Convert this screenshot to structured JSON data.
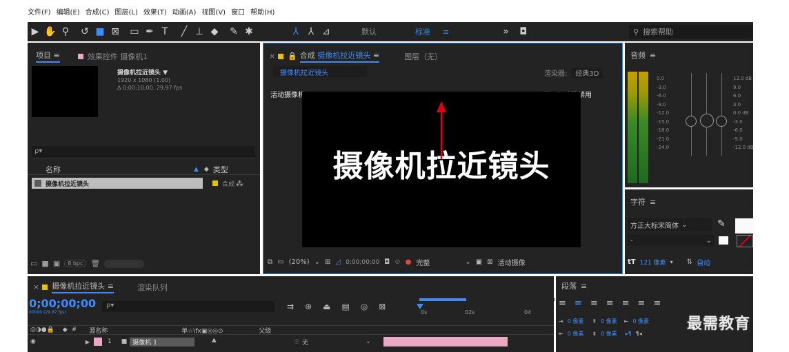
{
  "menubar": {
    "items": [
      "文件(F)",
      "编辑(E)",
      "合成(C)",
      "图层(L)",
      "效果(T)",
      "动画(A)",
      "视图(V)",
      "窗口",
      "帮助(H)"
    ]
  },
  "toolbar": {
    "workspace_default": "默认",
    "workspace_standard": "标准",
    "workspace_menu": "≡",
    "overflow": "»",
    "search_placeholder": "搜索帮助"
  },
  "project_panel": {
    "tab_project": "项目",
    "tab_menu": "≡",
    "tab_effects": "效果控件 摄像机1",
    "selected_name": "摄像机拉近镜头 ▼",
    "selected_info_1": "1920 x 1080 (1.00)",
    "selected_info_2": "Δ 0;00;10;00, 29.97 fps",
    "search_icon_text": "ρ▾",
    "col_name": "名称",
    "col_type": "类型",
    "item_name": "摄像机拉近镜头",
    "item_type": "合成",
    "bpc": "8 bpc"
  },
  "composition_panel": {
    "tab_label_prefix": "合成",
    "tab_comp_name": "摄像机拉近镜头",
    "tab_menu": "≡",
    "layer_tab": "图层（无）",
    "breadcrumb": "摄像机拉近镜头",
    "renderer_label": "渲染器:",
    "renderer_value": "经典3D",
    "active_camera": "活动摄像机",
    "gpu_notice": "显示加速已禁用",
    "viewer_text": "摄像机拉近镜头",
    "zoom": "(20%)",
    "timecode": "0;00;00;00",
    "quality": "完整",
    "view_camera": "活动摄像"
  },
  "audio_panel": {
    "title": "音频",
    "menu": "≡",
    "scale_left": [
      "0.0",
      "-3.0",
      "-6.0",
      "-9.0",
      "-12.0",
      "-15.0",
      "-18.0",
      "-21.0",
      "-24.0"
    ],
    "scale_right": [
      "12.0 dB",
      "9.0",
      "6.0",
      "3.0",
      "0.0 dB",
      "-3.0",
      "-6.0",
      "-9.0",
      "-12.0 dB"
    ]
  },
  "character_panel": {
    "title": "字符",
    "menu": "≡",
    "font_family": "方正大标宋简体",
    "font_style": "-",
    "size": "121 像素",
    "leading": "自动"
  },
  "timeline_panel": {
    "tab_comp": "摄像机拉近镜头",
    "tab_menu": "≡",
    "tab_render": "渲染队列",
    "timecode": "0;00;00;00",
    "timecode_sub": "00000 (29.97 fps)",
    "search_icon_text": "ρ▾",
    "ruler_labels": [
      "0s",
      "02s",
      "04"
    ],
    "col_layer_name": "源名称",
    "col_switches": "单☆\\fx▣◎◎⊙",
    "col_parent": "父级",
    "layer_index": "1",
    "layer_name": "摄像机 1",
    "layer_parent": "无"
  },
  "paragraph_panel": {
    "title": "段落",
    "menu": "≡",
    "indent_label_1": "0 像素",
    "indent_label_2": "0 像素",
    "indent_label_3": "0 像素",
    "indent_label_4": "0 像素",
    "indent_label_5": "0 像素"
  },
  "watermark": "最需教育",
  "colors": {
    "accent_blue": "#3d8bff",
    "comp_label_yellow": "#e8c200",
    "pink_label": "#e9a9c4",
    "red_arrow": "#e0001a"
  }
}
